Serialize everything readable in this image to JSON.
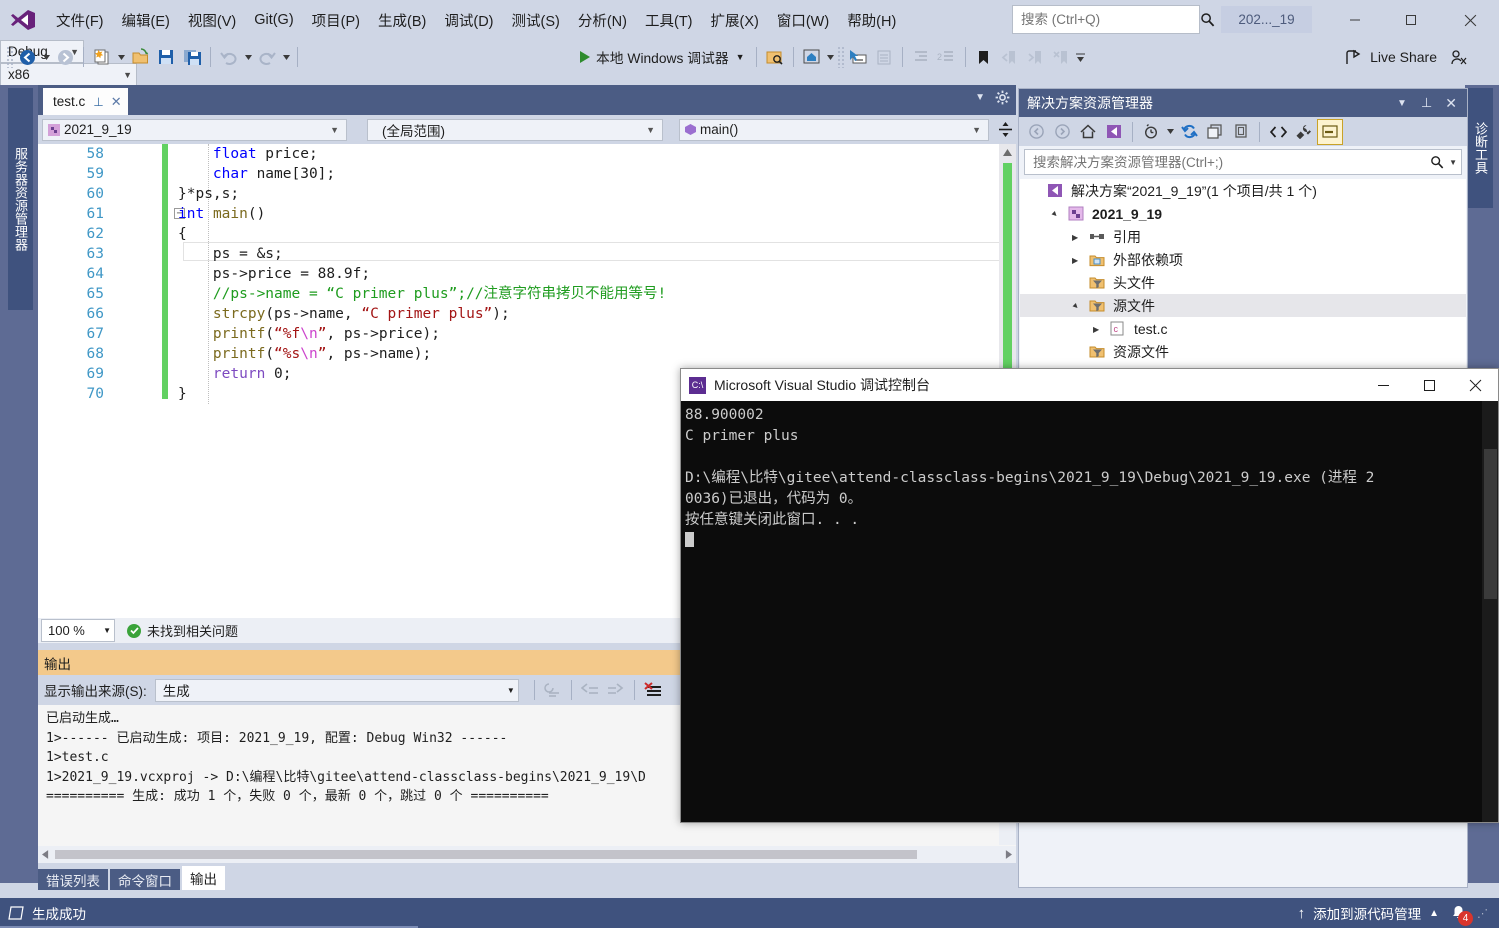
{
  "titlebar": {
    "menu": [
      "文件(F)",
      "编辑(E)",
      "视图(V)",
      "Git(G)",
      "项目(P)",
      "生成(B)",
      "调试(D)",
      "测试(S)",
      "分析(N)",
      "工具(T)",
      "扩展(X)",
      "窗口(W)",
      "帮助(H)"
    ],
    "search_placeholder": "搜索 (Ctrl+Q)",
    "search_value": "",
    "window_name": "202..._19",
    "minimize": "—",
    "maximize": "▢",
    "close": "✕"
  },
  "toolbar": {
    "config": "Debug",
    "platform": "x86",
    "run_label": "本地 Windows 调试器",
    "live_share": "Live Share"
  },
  "docks": {
    "left_vertical": "服务器资源管理器",
    "right_vertical": "诊断工具"
  },
  "editor": {
    "tab_name": "test.c",
    "tab_pin": "⌐",
    "tab_close": "✕",
    "nav_project": "2021_9_19",
    "nav_scope": "(全局范围)",
    "nav_member": "main()",
    "zoom": "100 %",
    "status_issues": "未找到相关问题",
    "lines": [
      {
        "num": "58",
        "segs": [
          {
            "t": "    ",
            "c": "pl"
          },
          {
            "t": "float",
            "c": "k"
          },
          {
            "t": " price;",
            "c": "pl"
          }
        ]
      },
      {
        "num": "59",
        "segs": [
          {
            "t": "    ",
            "c": "pl"
          },
          {
            "t": "char",
            "c": "k"
          },
          {
            "t": " name[30];",
            "c": "pl"
          }
        ]
      },
      {
        "num": "60",
        "segs": [
          {
            "t": "}*ps,s;",
            "c": "pl"
          }
        ]
      },
      {
        "num": "61",
        "segs": [
          {
            "t": "int",
            "c": "k"
          },
          {
            "t": " ",
            "c": "pl"
          },
          {
            "t": "main",
            "c": "fn"
          },
          {
            "t": "()",
            "c": "pl"
          }
        ]
      },
      {
        "num": "62",
        "segs": [
          {
            "t": "{",
            "c": "pl"
          }
        ]
      },
      {
        "num": "63",
        "segs": [
          {
            "t": "    ps = &s;",
            "c": "pl"
          }
        ]
      },
      {
        "num": "64",
        "segs": [
          {
            "t": "    ps->price = 88.9f;",
            "c": "pl"
          }
        ]
      },
      {
        "num": "65",
        "segs": [
          {
            "t": "    //ps->name = “C primer plus”;//注意字符串拷贝不能用等号!",
            "c": "cm"
          }
        ]
      },
      {
        "num": "66",
        "segs": [
          {
            "t": "    ",
            "c": "pl"
          },
          {
            "t": "strcpy",
            "c": "fn"
          },
          {
            "t": "(ps->name, ",
            "c": "pl"
          },
          {
            "t": "“C primer plus”",
            "c": "str"
          },
          {
            "t": ");",
            "c": "pl"
          }
        ]
      },
      {
        "num": "67",
        "segs": [
          {
            "t": "    ",
            "c": "pl"
          },
          {
            "t": "printf",
            "c": "fn"
          },
          {
            "t": "(",
            "c": "pl"
          },
          {
            "t": "“%f",
            "c": "str"
          },
          {
            "t": "\\n",
            "c": "esc"
          },
          {
            "t": "”",
            "c": "str"
          },
          {
            "t": ", ps->price);",
            "c": "pl"
          }
        ]
      },
      {
        "num": "68",
        "segs": [
          {
            "t": "    ",
            "c": "pl"
          },
          {
            "t": "printf",
            "c": "fn"
          },
          {
            "t": "(",
            "c": "pl"
          },
          {
            "t": "“%s",
            "c": "str"
          },
          {
            "t": "\\n",
            "c": "esc"
          },
          {
            "t": "”",
            "c": "str"
          },
          {
            "t": ", ps->name);",
            "c": "pl"
          }
        ]
      },
      {
        "num": "69",
        "segs": [
          {
            "t": "    ",
            "c": "pl"
          },
          {
            "t": "return",
            "c": "kc"
          },
          {
            "t": " 0;",
            "c": "pl"
          }
        ]
      },
      {
        "num": "70",
        "segs": [
          {
            "t": "}",
            "c": "pl"
          }
        ]
      }
    ]
  },
  "solution_explorer": {
    "title": "解决方案资源管理器",
    "search_placeholder": "搜索解决方案资源管理器(Ctrl+;)",
    "tree": [
      {
        "label": "解决方案“2021_9_19”(1 个项目/共 1 个)",
        "indent": 0,
        "arrow": "",
        "icon": "solution",
        "bold": false
      },
      {
        "label": "2021_9_19",
        "indent": 1,
        "arrow": "▲",
        "icon": "project",
        "bold": true
      },
      {
        "label": "引用",
        "indent": 2,
        "arrow": "▶",
        "icon": "references",
        "bold": false
      },
      {
        "label": "外部依赖项",
        "indent": 2,
        "arrow": "▶",
        "icon": "extdeps",
        "bold": false
      },
      {
        "label": "头文件",
        "indent": 2,
        "arrow": "",
        "icon": "filter",
        "bold": false
      },
      {
        "label": "源文件",
        "indent": 2,
        "arrow": "▲",
        "icon": "filter",
        "bold": false,
        "selected": true
      },
      {
        "label": "test.c",
        "indent": 3,
        "arrow": "▶",
        "icon": "cfile",
        "bold": false
      },
      {
        "label": "资源文件",
        "indent": 2,
        "arrow": "",
        "icon": "filter",
        "bold": false
      }
    ]
  },
  "output_panel": {
    "title": "输出",
    "source_label": "显示输出来源(S):",
    "source_value": "生成",
    "text": "已启动生成…\n1>------ 已启动生成: 项目: 2021_9_19, 配置: Debug Win32 ------\n1>test.c\n1>2021_9_19.vcxproj -> D:\\编程\\比特\\gitee\\attend-classclass-begins\\2021_9_19\\D\n========== 生成: 成功 1 个，失败 0 个，最新 0 个，跳过 0 个 =========="
  },
  "bottom_tabs": [
    {
      "label": "错误列表",
      "active": false
    },
    {
      "label": "命令窗口",
      "active": false
    },
    {
      "label": "输出",
      "active": true
    }
  ],
  "statusbar": {
    "build_status": "生成成功",
    "source_control": "添加到源代码管理",
    "notification_count": "4"
  },
  "console_window": {
    "title": "Microsoft Visual Studio 调试控制台",
    "icon_label": "C:\\",
    "minimize": "—",
    "maximize": "▢",
    "close": "✕",
    "text": "88.900002\nC primer plus\n\nD:\\编程\\比特\\gitee\\attend-classclass-begins\\2021_9_19\\Debug\\2021_9_19.exe (进程 2\n0036)已退出，代码为 0。\n按任意键关闭此窗口. . ."
  },
  "colors": {
    "chrome": "#cfd6e5",
    "status_blue": "#3f527e",
    "dock_blue": "#4b5c84",
    "output_title": "#f3c98b",
    "change_green": "#62d162",
    "badge_red": "#d9352c"
  }
}
